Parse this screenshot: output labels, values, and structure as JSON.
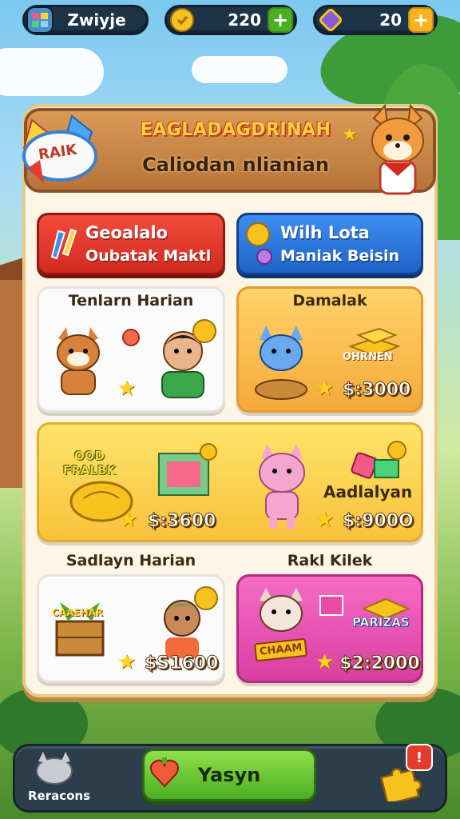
{
  "resources": [
    {
      "label": "Zwiyje"
    },
    {
      "value": "220",
      "plus": "+"
    },
    {
      "value": "20",
      "plus": "+"
    }
  ],
  "banner": {
    "badge": "RAIK",
    "title": "EAGLADAGDRINAH",
    "subtitle": "Caliodan nlianian"
  },
  "action_buttons": [
    {
      "line1": "Geoalalo",
      "line2": "Oubatak Maktl"
    },
    {
      "line1": "Wilh Lota",
      "line2": "Maniak Beisin"
    }
  ],
  "cards": [
    {
      "title": "Tenlarn Harian"
    },
    {
      "title": "Damalak",
      "tag": "OHRNEN",
      "price": "$:3000"
    },
    {
      "badge": "OOD FRALBK",
      "price": "$:3600",
      "title": "Aadlalyan",
      "price2": "$:900O"
    },
    {
      "title": "Sadlayn Harian",
      "crate": "CAAEHAR",
      "price": "$S1600"
    },
    {
      "title": "Rakl Kilek",
      "tag": "PARIZAS",
      "sign": "CHAAM",
      "price": "$2:2000"
    }
  ],
  "bottom": {
    "left_label": "Reracons",
    "play_label": "Yasyn",
    "notif": "!"
  },
  "colors": {
    "red_button": "#e0392b",
    "blue_button": "#2f7fe2",
    "play_button": "#5cc02c",
    "pink_card": "#ea4fb3",
    "orange_card": "#f8b84a"
  }
}
